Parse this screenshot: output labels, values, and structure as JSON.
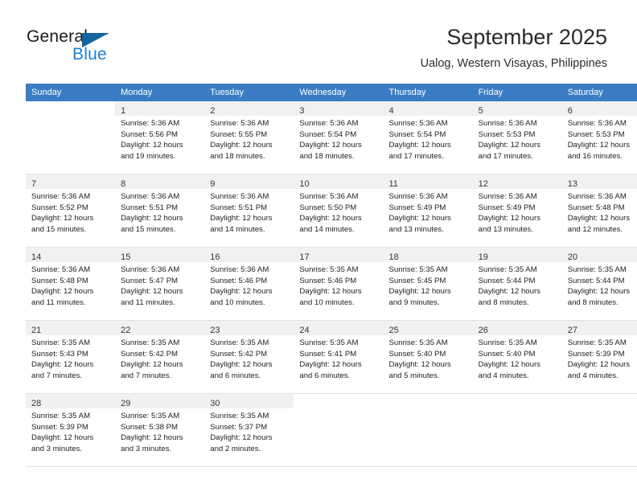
{
  "brand": {
    "name_top": "General",
    "name_bottom": "Blue",
    "triangle_color": "#1464a0",
    "blue_text_color": "#1f7fd0"
  },
  "header": {
    "title": "September 2025",
    "subtitle": "Ualog, Western Visayas, Philippines"
  },
  "calendar": {
    "header_bg": "#3b7dc4",
    "header_text_color": "#ffffff",
    "daynum_band_bg": "#f1f1f1",
    "weekdays": [
      "Sunday",
      "Monday",
      "Tuesday",
      "Wednesday",
      "Thursday",
      "Friday",
      "Saturday"
    ],
    "weeks": [
      [
        {
          "day": "",
          "lines": []
        },
        {
          "day": "1",
          "lines": [
            "Sunrise: 5:36 AM",
            "Sunset: 5:56 PM",
            "Daylight: 12 hours",
            "and 19 minutes."
          ]
        },
        {
          "day": "2",
          "lines": [
            "Sunrise: 5:36 AM",
            "Sunset: 5:55 PM",
            "Daylight: 12 hours",
            "and 18 minutes."
          ]
        },
        {
          "day": "3",
          "lines": [
            "Sunrise: 5:36 AM",
            "Sunset: 5:54 PM",
            "Daylight: 12 hours",
            "and 18 minutes."
          ]
        },
        {
          "day": "4",
          "lines": [
            "Sunrise: 5:36 AM",
            "Sunset: 5:54 PM",
            "Daylight: 12 hours",
            "and 17 minutes."
          ]
        },
        {
          "day": "5",
          "lines": [
            "Sunrise: 5:36 AM",
            "Sunset: 5:53 PM",
            "Daylight: 12 hours",
            "and 17 minutes."
          ]
        },
        {
          "day": "6",
          "lines": [
            "Sunrise: 5:36 AM",
            "Sunset: 5:53 PM",
            "Daylight: 12 hours",
            "and 16 minutes."
          ]
        }
      ],
      [
        {
          "day": "7",
          "lines": [
            "Sunrise: 5:36 AM",
            "Sunset: 5:52 PM",
            "Daylight: 12 hours",
            "and 15 minutes."
          ]
        },
        {
          "day": "8",
          "lines": [
            "Sunrise: 5:36 AM",
            "Sunset: 5:51 PM",
            "Daylight: 12 hours",
            "and 15 minutes."
          ]
        },
        {
          "day": "9",
          "lines": [
            "Sunrise: 5:36 AM",
            "Sunset: 5:51 PM",
            "Daylight: 12 hours",
            "and 14 minutes."
          ]
        },
        {
          "day": "10",
          "lines": [
            "Sunrise: 5:36 AM",
            "Sunset: 5:50 PM",
            "Daylight: 12 hours",
            "and 14 minutes."
          ]
        },
        {
          "day": "11",
          "lines": [
            "Sunrise: 5:36 AM",
            "Sunset: 5:49 PM",
            "Daylight: 12 hours",
            "and 13 minutes."
          ]
        },
        {
          "day": "12",
          "lines": [
            "Sunrise: 5:36 AM",
            "Sunset: 5:49 PM",
            "Daylight: 12 hours",
            "and 13 minutes."
          ]
        },
        {
          "day": "13",
          "lines": [
            "Sunrise: 5:36 AM",
            "Sunset: 5:48 PM",
            "Daylight: 12 hours",
            "and 12 minutes."
          ]
        }
      ],
      [
        {
          "day": "14",
          "lines": [
            "Sunrise: 5:36 AM",
            "Sunset: 5:48 PM",
            "Daylight: 12 hours",
            "and 11 minutes."
          ]
        },
        {
          "day": "15",
          "lines": [
            "Sunrise: 5:36 AM",
            "Sunset: 5:47 PM",
            "Daylight: 12 hours",
            "and 11 minutes."
          ]
        },
        {
          "day": "16",
          "lines": [
            "Sunrise: 5:36 AM",
            "Sunset: 5:46 PM",
            "Daylight: 12 hours",
            "and 10 minutes."
          ]
        },
        {
          "day": "17",
          "lines": [
            "Sunrise: 5:35 AM",
            "Sunset: 5:46 PM",
            "Daylight: 12 hours",
            "and 10 minutes."
          ]
        },
        {
          "day": "18",
          "lines": [
            "Sunrise: 5:35 AM",
            "Sunset: 5:45 PM",
            "Daylight: 12 hours",
            "and 9 minutes."
          ]
        },
        {
          "day": "19",
          "lines": [
            "Sunrise: 5:35 AM",
            "Sunset: 5:44 PM",
            "Daylight: 12 hours",
            "and 8 minutes."
          ]
        },
        {
          "day": "20",
          "lines": [
            "Sunrise: 5:35 AM",
            "Sunset: 5:44 PM",
            "Daylight: 12 hours",
            "and 8 minutes."
          ]
        }
      ],
      [
        {
          "day": "21",
          "lines": [
            "Sunrise: 5:35 AM",
            "Sunset: 5:43 PM",
            "Daylight: 12 hours",
            "and 7 minutes."
          ]
        },
        {
          "day": "22",
          "lines": [
            "Sunrise: 5:35 AM",
            "Sunset: 5:42 PM",
            "Daylight: 12 hours",
            "and 7 minutes."
          ]
        },
        {
          "day": "23",
          "lines": [
            "Sunrise: 5:35 AM",
            "Sunset: 5:42 PM",
            "Daylight: 12 hours",
            "and 6 minutes."
          ]
        },
        {
          "day": "24",
          "lines": [
            "Sunrise: 5:35 AM",
            "Sunset: 5:41 PM",
            "Daylight: 12 hours",
            "and 6 minutes."
          ]
        },
        {
          "day": "25",
          "lines": [
            "Sunrise: 5:35 AM",
            "Sunset: 5:40 PM",
            "Daylight: 12 hours",
            "and 5 minutes."
          ]
        },
        {
          "day": "26",
          "lines": [
            "Sunrise: 5:35 AM",
            "Sunset: 5:40 PM",
            "Daylight: 12 hours",
            "and 4 minutes."
          ]
        },
        {
          "day": "27",
          "lines": [
            "Sunrise: 5:35 AM",
            "Sunset: 5:39 PM",
            "Daylight: 12 hours",
            "and 4 minutes."
          ]
        }
      ],
      [
        {
          "day": "28",
          "lines": [
            "Sunrise: 5:35 AM",
            "Sunset: 5:39 PM",
            "Daylight: 12 hours",
            "and 3 minutes."
          ]
        },
        {
          "day": "29",
          "lines": [
            "Sunrise: 5:35 AM",
            "Sunset: 5:38 PM",
            "Daylight: 12 hours",
            "and 3 minutes."
          ]
        },
        {
          "day": "30",
          "lines": [
            "Sunrise: 5:35 AM",
            "Sunset: 5:37 PM",
            "Daylight: 12 hours",
            "and 2 minutes."
          ]
        },
        {
          "day": "",
          "lines": []
        },
        {
          "day": "",
          "lines": []
        },
        {
          "day": "",
          "lines": []
        },
        {
          "day": "",
          "lines": []
        }
      ]
    ]
  }
}
